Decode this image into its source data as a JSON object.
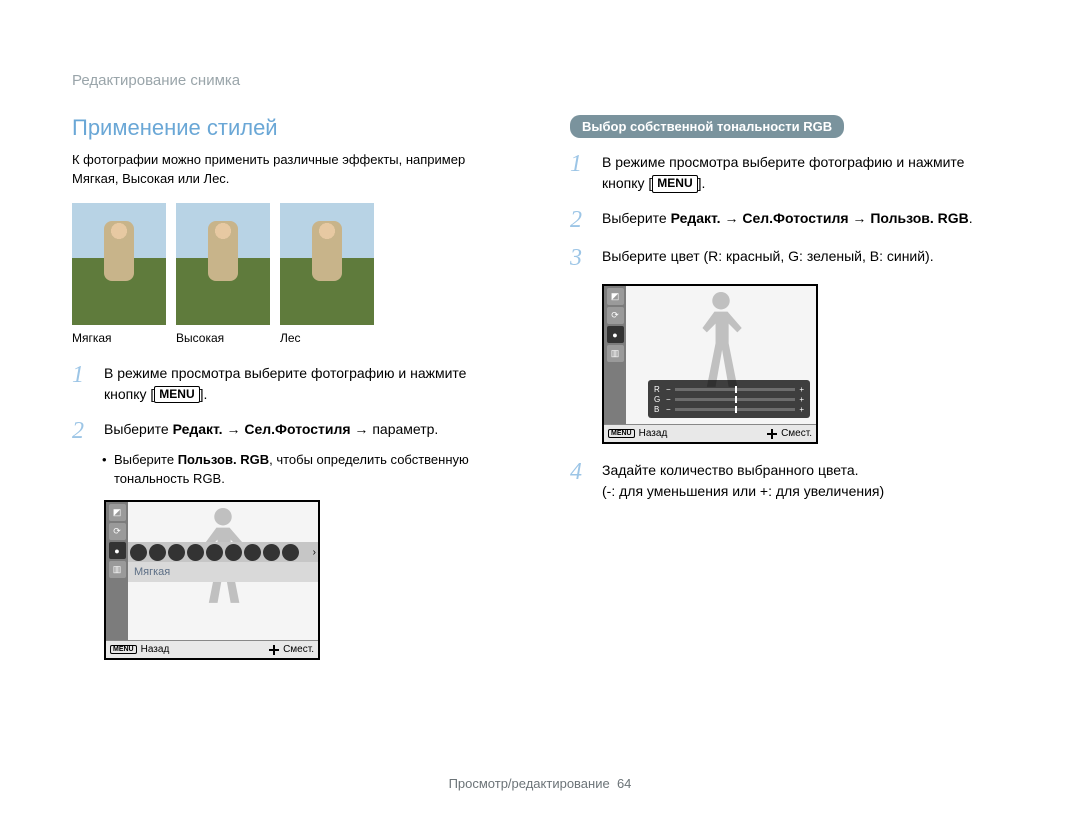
{
  "breadcrumb": "Редактирование снимка",
  "section_title": "Применение стилей",
  "intro": "К фотографии можно применить различные эффекты, например Мягкая, Высокая или Лес.",
  "sample_labels": [
    "Мягкая",
    "Высокая",
    "Лес"
  ],
  "left_steps": {
    "s1_a": "В режиме просмотра выберите фотографию и нажмите кнопку [",
    "s1_b": "].",
    "s2_a": "Выберите ",
    "s2_b": "Редакт.",
    "s2_c": " → ",
    "s2_d": "Сел.Фотостиля",
    "s2_e": " → параметр.",
    "bullet_a": "Выберите ",
    "bullet_b": "Пользов. RGB",
    "bullet_c": ", чтобы определить собственную тональность RGB."
  },
  "menu_label": "MENU",
  "screen1": {
    "style_active": "Мягкая",
    "back": "Назад",
    "move": "Смест."
  },
  "badge": "Выбор собственной тональности RGB",
  "right_steps": {
    "s1_a": "В режиме просмотра выберите фотографию и нажмите кнопку [",
    "s1_b": "].",
    "s2_a": "Выберите ",
    "s2_b": "Редакт.",
    "s2_c": " → ",
    "s2_d": "Сел.Фотостиля",
    "s2_e": " → ",
    "s2_f": "Пользов. RGB",
    "s2_g": ".",
    "s3": "Выберите цвет (R: красный, G: зеленый, B: синий).",
    "s4_a": "Задайте количество выбранного цвета.",
    "s4_b": "(-: для уменьшения или +: для увеличения)"
  },
  "screen2": {
    "ch_r": "R",
    "ch_g": "G",
    "ch_b": "B",
    "minus": "−",
    "plus": "+",
    "back": "Назад",
    "move": "Смест."
  },
  "footer_label": "Просмотр/редактирование",
  "footer_page": "64"
}
